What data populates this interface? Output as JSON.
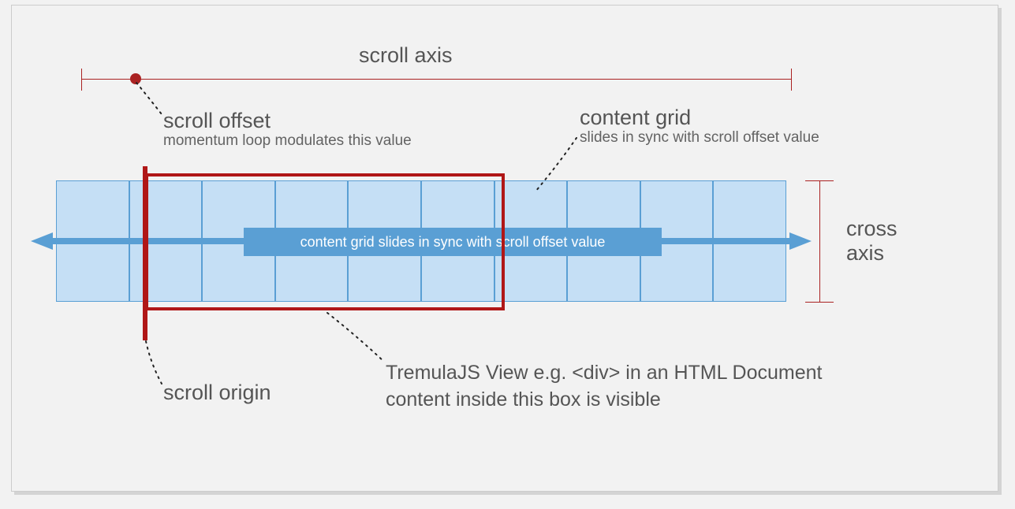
{
  "labels": {
    "scroll_axis": "scroll axis",
    "scroll_offset_title": "scroll offset",
    "scroll_offset_sub": "momentum loop modulates this value",
    "content_grid_title": "content grid",
    "content_grid_sub": "slides in sync with scroll offset value",
    "cross_axis_line1": "cross",
    "cross_axis_line2": "axis",
    "ribbon": "content grid slides in sync with scroll offset value",
    "scroll_origin": "scroll origin",
    "view_line1": "TremulaJS View   e.g. <div> in an HTML Document",
    "view_line2": "content inside this box is visible"
  },
  "colors": {
    "accent_red": "#aa2222",
    "view_red": "#b01717",
    "grid_fill": "#c5dff5",
    "grid_stroke": "#5a9fd4",
    "arrow_blue": "#5a9fd4",
    "text": "#555555",
    "panel_bg": "#f2f2f2"
  },
  "grid": {
    "cols": 10,
    "rows": 2
  }
}
